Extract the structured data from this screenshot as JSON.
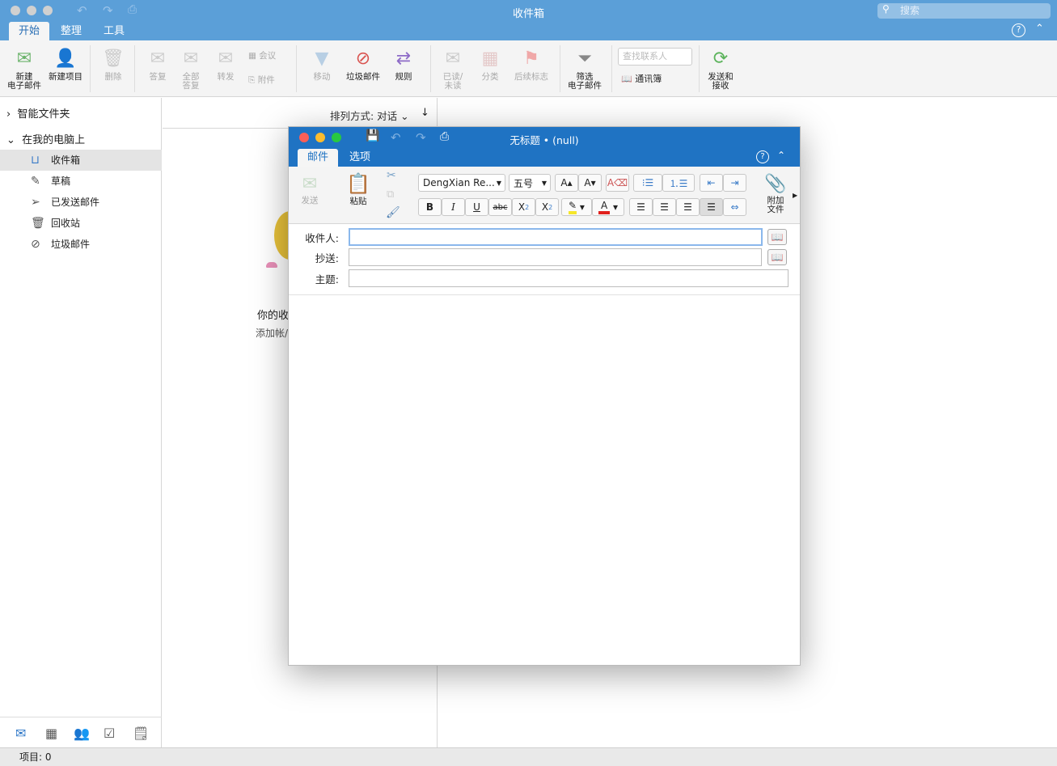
{
  "window": {
    "title": "收件箱",
    "search_placeholder": "搜索"
  },
  "tabs": [
    "开始",
    "整理",
    "工具"
  ],
  "ribbon": {
    "new_email": "新建\n电子邮件",
    "new_item": "新建项目",
    "delete": "删除",
    "reply": "答复",
    "reply_all": "全部\n答复",
    "forward": "转发",
    "meeting": "会议",
    "attachment": "附件",
    "move": "移动",
    "junk": "垃圾邮件",
    "rules": "规则",
    "read_unread": "已读/\n未读",
    "categorize": "分类",
    "follow_up": "后续标志",
    "filter": "筛选\n电子邮件",
    "find_contact_placeholder": "查找联系人",
    "address_book": "通讯簿",
    "send_receive": "发送和\n接收"
  },
  "sidebar": {
    "smart_folders": "智能文件夹",
    "on_my_computer": "在我的电脑上",
    "items": [
      {
        "label": "收件箱",
        "icon": "inbox-icon",
        "selected": true
      },
      {
        "label": "草稿",
        "icon": "drafts-icon"
      },
      {
        "label": "已发送邮件",
        "icon": "sent-icon"
      },
      {
        "label": "回收站",
        "icon": "trash-icon"
      },
      {
        "label": "垃圾邮件",
        "icon": "junk-icon"
      }
    ]
  },
  "middle": {
    "sort": "排列方式: 对话",
    "empty_title": "你的收",
    "empty_sub": "添加帐/"
  },
  "status": {
    "items": "项目: 0"
  },
  "compose": {
    "title": "无标题 • (null)",
    "tabs": [
      "邮件",
      "选项"
    ],
    "send": "发送",
    "paste": "粘贴",
    "font": "DengXian Re...",
    "size": "五号",
    "attach": "附加\n文件",
    "to_label": "收件人:",
    "cc_label": "抄送:",
    "subject_label": "主题:",
    "to": "",
    "cc": "",
    "subject": "",
    "colors": {
      "highlight": "#f5e62a",
      "font_color": "#e0201c"
    }
  }
}
